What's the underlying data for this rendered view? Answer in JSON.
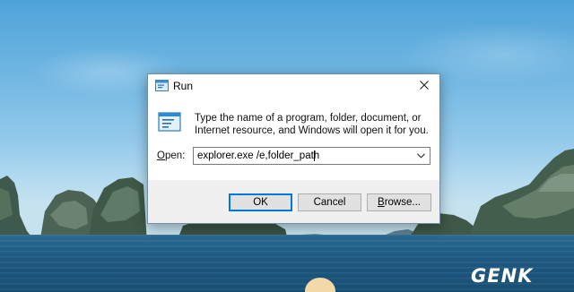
{
  "window": {
    "title": "Run",
    "description": "Type the name of a program, folder, document, or Internet resource, and Windows will open it for you.",
    "open_label_underlined": "O",
    "open_label_rest": "pen:",
    "open_value": "explorer.exe /e,folder_path"
  },
  "buttons": {
    "ok": "OK",
    "cancel": "Cancel",
    "browse_underlined": "B",
    "browse_rest": "rowse..."
  },
  "icons": {
    "app": "run-icon",
    "close": "close-icon",
    "dropdown": "chevron-down-icon"
  },
  "watermark": {
    "text": "GENK"
  },
  "colors": {
    "default_button_border": "#0078d7",
    "dialog_footer": "#f0f0f0",
    "sky_top": "#4fa3d8",
    "sea": "#1f5c84"
  }
}
